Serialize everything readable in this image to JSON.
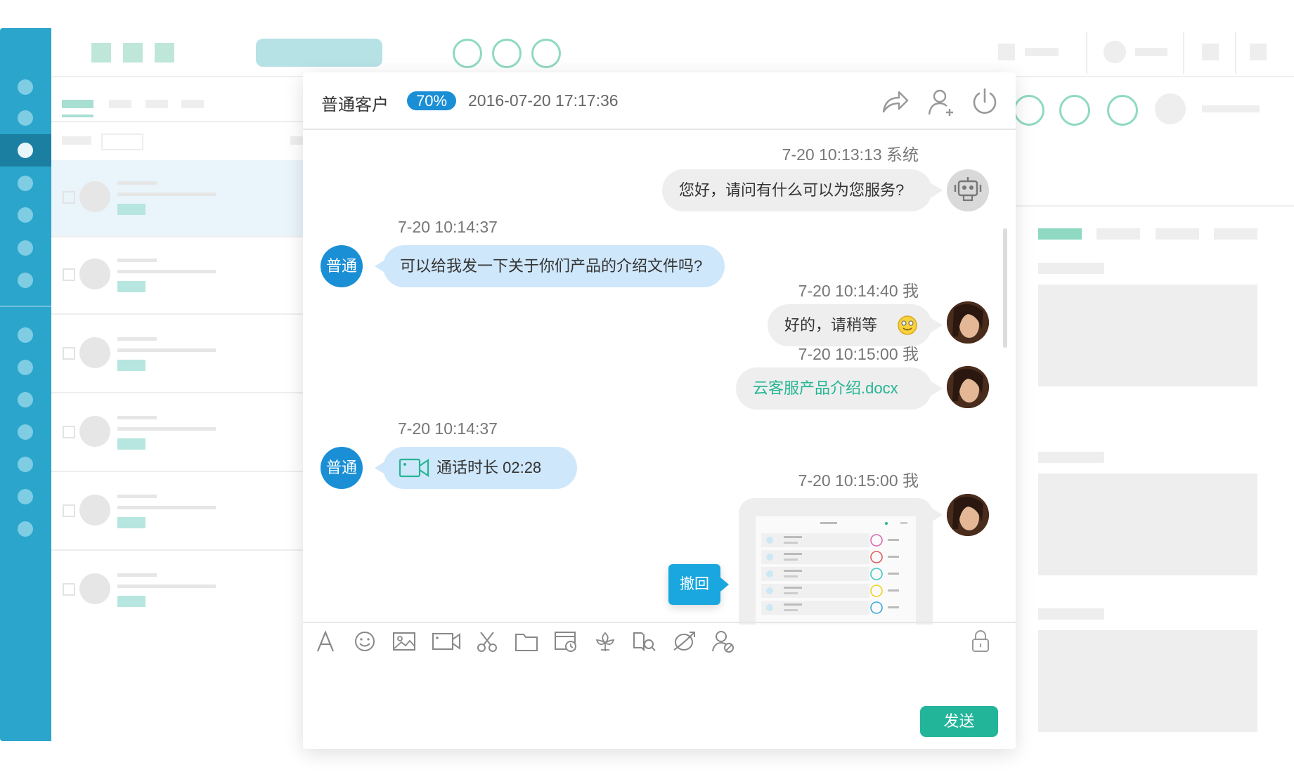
{
  "chat": {
    "customer_name": "普通客户",
    "satisfaction_badge": "70%",
    "session_time": "2016-07-20 17:17:36",
    "messages": [
      {
        "time": "7-20  10:13:13  系统",
        "text": "您好，请问有什么可以为您服务?"
      },
      {
        "time": "7-20  10:14:37",
        "text": "可以给我发一下关于你们产品的介绍文件吗?",
        "avatar": "普通"
      },
      {
        "time": "7-20  10:14:40  我",
        "text": "好的，请稍等"
      },
      {
        "time": "7-20  10:15:00  我",
        "text": "云客服产品介绍.docx"
      },
      {
        "time": "7-20  10:14:37",
        "text": "通话时长  02:28",
        "avatar": "普通"
      },
      {
        "time": "7-20  10:15:00  我"
      }
    ],
    "recall_label": "撤回",
    "send_label": "发送"
  },
  "icons": {
    "header": [
      "share-icon",
      "add-user-icon",
      "power-icon"
    ],
    "toolbar": [
      "font-icon",
      "emoji-icon",
      "image-icon",
      "video-icon",
      "screenshot-icon",
      "folder-icon",
      "history-icon",
      "flower-icon",
      "search-knowledge-icon",
      "transfer-icon",
      "user-settings-icon",
      "lock-icon"
    ]
  },
  "colors": {
    "sidebar": "#2ba5cb",
    "accent": "#1a8fd6",
    "incoming_bubble": "#cfe7fb",
    "outgoing_bubble": "#eeeeee",
    "file_link": "#25b593",
    "send_button": "#23b59a"
  }
}
